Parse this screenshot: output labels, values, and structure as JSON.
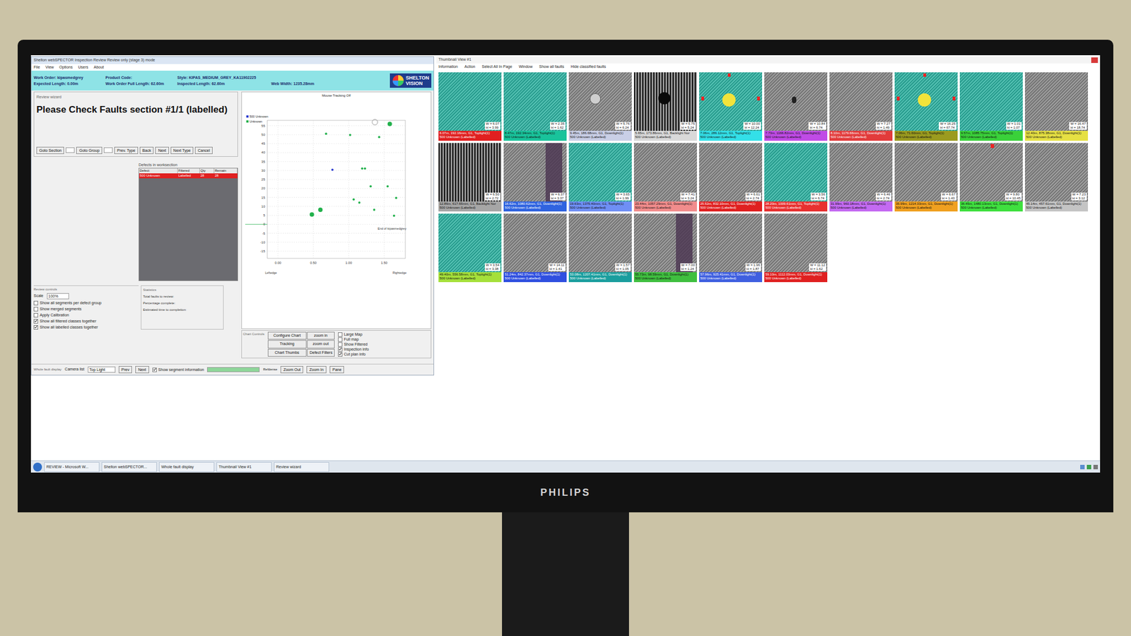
{
  "monitor": {
    "brand": "PHILIPS"
  },
  "left_window": {
    "title": "Shelton webSPECTOR Inspection Review Review only (stage 3) mode",
    "menu": [
      "File",
      "View",
      "Options",
      "Users",
      "About"
    ],
    "info": [
      [
        "Work Order: kipasmedgrey",
        "Product Code:",
        "Style: KIPAS_MEDIUM_GREY_KA11902225",
        ""
      ],
      [
        "Expected Length: 0.00m",
        "Work Order Full Length: 62.60m",
        "Inspected Length: 62.60m",
        "Web Width: 1235.28mm"
      ]
    ],
    "logo": [
      "SHELTON",
      "VISION"
    ],
    "wizard": {
      "label": "Review wizard",
      "title": "Please Check Faults section #1/1 (labelled)",
      "buttons": [
        "Goto Section",
        "Goto Group",
        "Prev. Type",
        "Back",
        "Next",
        "Next Type",
        "Cancel"
      ]
    },
    "defects": {
      "label": "Defects in worksection",
      "columns": [
        "Defect",
        "Filtered",
        "Qty",
        "Remain"
      ],
      "rows": [
        {
          "cells": [
            "500 Unknown",
            "Labelled",
            "28",
            "28"
          ],
          "selected": true
        }
      ]
    },
    "controls": {
      "label": "Review controls",
      "scale_label": "Scale",
      "scale_value": "100%",
      "checkboxes": [
        {
          "label": "Show all segments per defect group",
          "checked": false
        },
        {
          "label": "Show merged segments",
          "checked": false
        },
        {
          "label": "Apply Calibration",
          "checked": false
        },
        {
          "label": "Show all filtered classes together",
          "checked": true
        },
        {
          "label": "Show all labelled classes together",
          "checked": true
        }
      ]
    },
    "statistics": {
      "label": "Statistics",
      "lines": [
        "Total faults to review:",
        "Percentage complete:",
        "Estimated time to completion:"
      ]
    },
    "chart": {
      "title": "Mouse Tracking Off",
      "legend": [
        {
          "label": "500 Unknown",
          "color": "#2f3fd0"
        },
        {
          "label": "Unknown",
          "color": "#22b14c"
        }
      ],
      "y_ticks": [
        "55",
        "50",
        "45",
        "40",
        "35",
        "30",
        "25",
        "20",
        "15",
        "10",
        "5",
        "0",
        "-5",
        "-10",
        "-15"
      ],
      "x_ticks": [
        "0.00",
        "0.50",
        "1.00",
        "1.50"
      ],
      "x_left_label": "Leftedge",
      "x_right_label": "Rightedge",
      "end_label": "End of kipasmedgrey",
      "series": [
        {
          "name": "Unknown",
          "kind": "small",
          "color": "#22b14c",
          "x": [
            1.02,
            0.68,
            1.43,
            1.19,
            1.23,
            1.31,
            1.55,
            1.07,
            1.67,
            1.15,
            1.36,
            1.64
          ],
          "y": [
            49.8,
            50.5,
            48.7,
            31.1,
            31.1,
            21.2,
            21.2,
            13.9,
            14.7,
            12.1,
            8.1,
            4.8
          ]
        },
        {
          "name": "Unknown large",
          "kind": "big",
          "color": "#22b14c",
          "x": [
            1.58,
            0.6,
            0.48
          ],
          "y": [
            56,
            8.1,
            5.5
          ]
        },
        {
          "name": "500 Unknown",
          "kind": "small",
          "color": "#2f3fd0",
          "x": [
            0.77
          ],
          "y": [
            30.4
          ]
        },
        {
          "name": "Current",
          "kind": "outline",
          "color": "#9a9a9a",
          "x": [
            1.37
          ],
          "y": [
            57
          ]
        }
      ]
    },
    "chart_controls": {
      "label": "Chart Controls",
      "buttons": [
        "Configure Chart",
        "zoom in",
        "Tracking",
        "zoom out",
        "Chart Thumbs",
        "Defect Filters"
      ],
      "checkboxes": [
        {
          "label": "Large Map",
          "checked": false
        },
        {
          "label": "Full map",
          "checked": false
        },
        {
          "label": "Show Filtered",
          "checked": false
        },
        {
          "label": "Inspection info",
          "checked": true
        },
        {
          "label": "Cut plan info",
          "checked": true
        }
      ]
    },
    "fault_display": {
      "label": "Whole fault display",
      "camera_label": "Camera list",
      "camera_value": "Top Light",
      "prev": "Prev",
      "next": "Next",
      "segment_label": "Show segment information",
      "segment_checked": true,
      "bar_level": 1,
      "bar_label": "Refdense",
      "buttons": [
        "Zoom Out",
        "Zoom In",
        "Pane"
      ]
    }
  },
  "thumb_window": {
    "title": "Thumbnail View #1",
    "menu": [
      "Information",
      "Action",
      "Select All In Page",
      "Window",
      "Show all faults",
      "Hide classified faults"
    ],
    "thumbs": [
      {
        "image": "teal",
        "mark": "none",
        "w": "W = 6.07",
        "h": "H = 3.99",
        "line1": "6.07m, 192.16mm, G1, Toplight(1)",
        "line2": "500 Unknown (Labelled)",
        "color": "#e02020"
      },
      {
        "image": "teal",
        "mark": "none",
        "w": "W = 2.35",
        "h": "H = 1.62",
        "line1": "8.47m, 192.34mm, G1, Toplight(1)",
        "line2": "500 Unknown (Labelled)",
        "color": "#19c39b"
      },
      {
        "image": "gray",
        "mark": "light-dot",
        "w": "W = 5.76",
        "h": "H = 6.24",
        "line1": "9.45m, 186.68mm, G1, Downlight(1)",
        "line2": "500 Unknown (Labelled)",
        "color": "#c9cfe6"
      },
      {
        "image": "dark",
        "mark": "dark-dot",
        "w": "W = 5.75",
        "h": "H = 5.24",
        "line1": "5.65m, 173.86mm, G1, Backlight Nor",
        "line2": "500 Unknown (Labelled)",
        "color": "#d9d9d9"
      },
      {
        "image": "teal",
        "mark": "yellow",
        "w": "W = 10.00",
        "h": "H = 12.24",
        "line1": "7.06m, 286.12mm, G1, Toplight(1)",
        "line2": "500 Unknown (Labelled)",
        "color": "#33e0e8"
      },
      {
        "image": "gray",
        "mark": "dark-small",
        "w": "W = 10.84",
        "h": "H = 6.74",
        "line1": "7.73m, 1166.82mm, G1, Downlight(1)",
        "line2": "500 Unknown (Labelled)",
        "color": "#c04be6"
      },
      {
        "image": "gray",
        "mark": "none",
        "w": "W = 7.27",
        "h": "H = 1.49",
        "line1": "8.10m, 1179.66mm, G1, Downlight(1)",
        "line2": "500 Unknown (Labelled)",
        "color": "#e23b3b"
      },
      {
        "image": "teal",
        "mark": "yellow",
        "w": "W = 16.25",
        "h": "H = 67.74",
        "line1": "7.06m, 71.60mm, G1, Toplight(1)",
        "line2": "500 Unknown (Labelled)",
        "color": "#9b9b1f"
      },
      {
        "image": "teal",
        "mark": "none",
        "w": "W = 1.01",
        "h": "H = 1.07",
        "line1": "9.57m, 1085.75mm, G1, Toplight(1)",
        "line2": "500 Unknown (Labelled)",
        "color": "#3ad13a"
      },
      {
        "image": "gray",
        "mark": "none",
        "w": "W = 16.47",
        "h": "H = 18.74",
        "line1": "12.40m, 875.38mm, G1, Downlight(1)",
        "line2": "500 Unknown (Labelled)",
        "color": "#e6e043"
      },
      {
        "image": "dark",
        "mark": "none",
        "w": "W = 6.50",
        "h": "H = 2.72",
        "line1": "12.86m, 617.65mm, G1, Backlight Nor",
        "line2": "500 Unknown (Labelled)",
        "color": "#a6a6a6"
      },
      {
        "image": "gray",
        "mark": "stripe",
        "w": "W = 6.37",
        "h": "H = 3.37",
        "line1": "16.62m, 1080.62mm, G1, Downlight(1)",
        "line2": "500 Unknown (Labelled)",
        "color": "#2f63e0"
      },
      {
        "image": "teal",
        "mark": "none",
        "w": "W = 3.65",
        "h": "H = 1.99",
        "line1": "19.63m, 1375.40mm, G1, Toplight(1)",
        "line2": "500 Unknown (Labelled)",
        "color": "#6f8ff5"
      },
      {
        "image": "gray",
        "mark": "none",
        "w": "W = 7.41",
        "h": "H = 3.24",
        "line1": "23.44m, 1057.29mm, G1, Downlight(1)",
        "line2": "500 Unknown (Labelled)",
        "color": "#f28c8c"
      },
      {
        "image": "gray",
        "mark": "none",
        "w": "W = 6.61",
        "h": "H = 2.74",
        "line1": "25.52m, 832.10mm, G1, Downlight(1)",
        "line2": "500 Unknown (Labelled)",
        "color": "#e02020"
      },
      {
        "image": "teal",
        "mark": "none",
        "w": "W = 3.56",
        "h": "H = 6.74",
        "line1": "28.20m, 1009.61mm, G1, Toplight(1)",
        "line2": "500 Unknown (Labelled)",
        "color": "#e83030"
      },
      {
        "image": "gray",
        "mark": "none",
        "w": "W = 6.46",
        "h": "H = 2.74",
        "line1": "31.99m, 960.18mm, G1, Downlight(1)",
        "line2": "500 Unknown (Labelled)",
        "color": "#c46af2"
      },
      {
        "image": "gray",
        "mark": "none",
        "w": "W = 6.67",
        "h": "H = 1.43",
        "line1": "35.99m, 1214.33mm, G1, Downlight(1)",
        "line2": "500 Unknown (Labelled)",
        "color": "#f0a020"
      },
      {
        "image": "gray",
        "mark": "red-mark",
        "w": "W = 9.80",
        "h": "H = 10.45",
        "line1": "36.45m, 1480.13mm, G1, Downlight(1)",
        "line2": "500 Unknown (Labelled)",
        "color": "#3fe03f"
      },
      {
        "image": "gray",
        "mark": "none",
        "w": "W = 7.23",
        "h": "H = 3.12",
        "line1": "45.14m, 457.61mm, G1, Downlight(1)",
        "line2": "500 Unknown (Labelled)",
        "color": "#c4c4c4"
      },
      {
        "image": "teal",
        "mark": "none",
        "w": "W = 3.54",
        "h": "H = 3.38",
        "line1": "49.40m, 556.58mm, G1, Toplight(1)",
        "line2": "500 Unknown (Labelled)",
        "color": "#a5e03a"
      },
      {
        "image": "gray",
        "mark": "none",
        "w": "W = 14.11",
        "h": "H = 1.41",
        "line1": "51.24m, 842.37mm, G1, Downlight(1)",
        "line2": "500 Unknown (Labelled)",
        "color": "#2f4fe0"
      },
      {
        "image": "gray",
        "mark": "none",
        "w": "W = 1.57",
        "h": "H = 1.05",
        "line1": "53.08m, 1207.41mm, G1, Downlight(1)",
        "line2": "500 Unknown (Labelled)",
        "color": "#1a9e9e"
      },
      {
        "image": "gray",
        "mark": "stripe",
        "w": "W = 7.00",
        "h": "H = 1.24",
        "line1": "55.73m, 98.59mm, G1, Downlight(1)",
        "line2": "500 Unknown (Labelled)",
        "color": "#3fbf3f"
      },
      {
        "image": "gray",
        "mark": "none",
        "w": "W = 1.96",
        "h": "H = 1.87",
        "line1": "57.96m, 925.41mm, G1, Downlight(1)",
        "line2": "500 Unknown (Labelled)",
        "color": "#3f5fe0"
      },
      {
        "image": "gray",
        "mark": "none",
        "w": "W = 11.12",
        "h": "H = 1.62",
        "line1": "59.10m, 1112.03mm, G1, Downlight(1)",
        "line2": "500 Unknown (Labelled)",
        "color": "#e02020"
      }
    ]
  },
  "taskbar": {
    "items": [
      "REVIEW - Microsoft W...",
      "Shelton webSPECTOR...",
      "Whole fault display",
      "Thumbnail View #1",
      "Review wizard"
    ]
  }
}
